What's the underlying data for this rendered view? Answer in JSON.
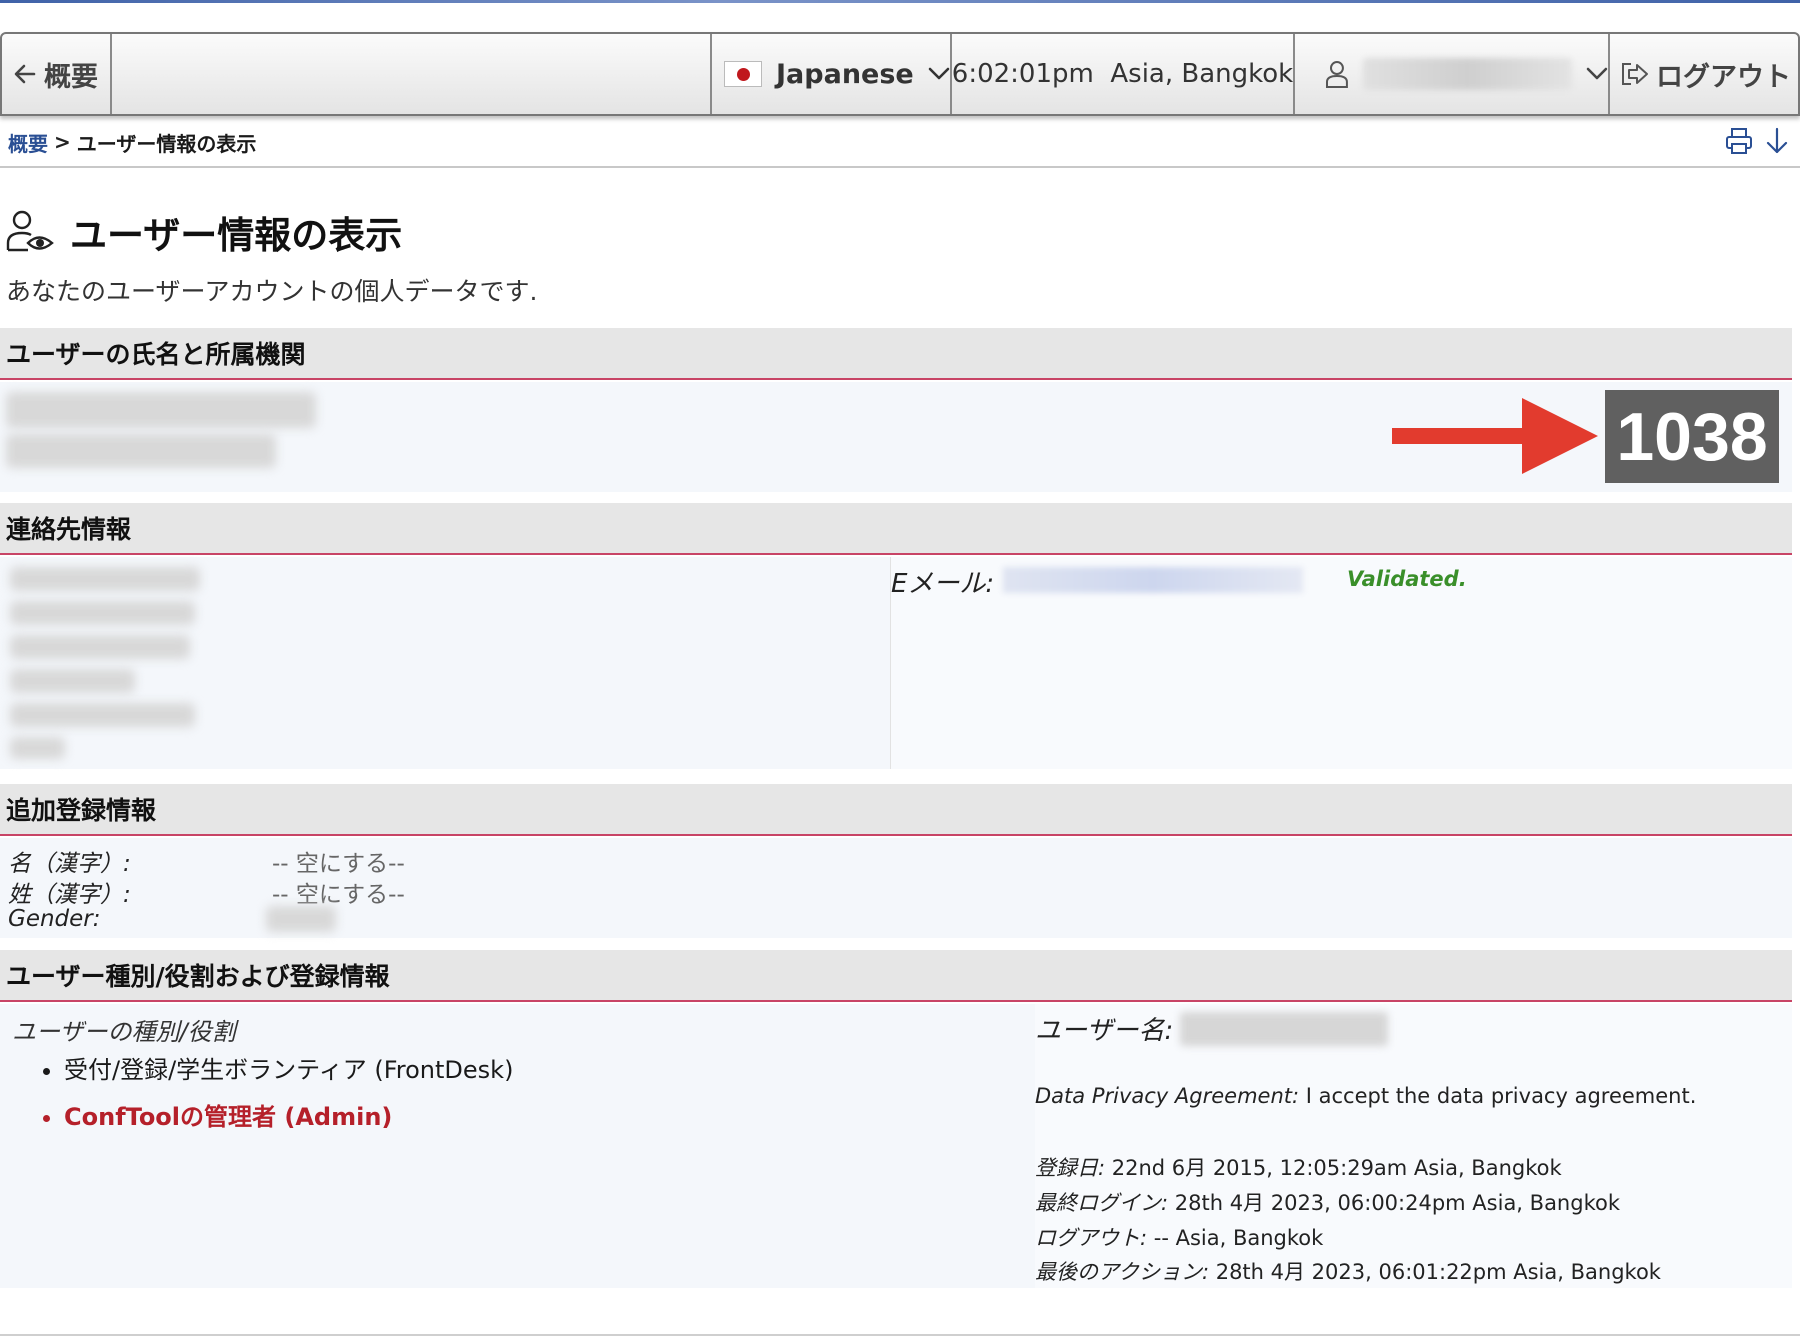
{
  "topbar": {
    "back_label": "概要",
    "language": "Japanese",
    "time": "6:02:01pm  Asia, Bangkok",
    "logout_label": "ログアウト"
  },
  "breadcrumb": {
    "home": "概要",
    "separator": ">",
    "current": "ユーザー情報の表示"
  },
  "page": {
    "title": "ユーザー情報の表示",
    "subtitle": "あなたのユーザーアカウントの個人データです."
  },
  "sections": {
    "name_affiliation": "ユーザーの氏名と所属機関",
    "contact": "連絡先情報",
    "additional": "追加登録情報",
    "roles": "ユーザー種別/役割および登録情報"
  },
  "user_id": "1038",
  "contact": {
    "email_label": "Eメール:",
    "validated": "Validated."
  },
  "additional": {
    "rows": [
      {
        "label": "名（漢字）:",
        "value": "-- 空にする--"
      },
      {
        "label": "姓（漢字）:",
        "value": "-- 空にする--"
      },
      {
        "label": "Gender:",
        "value": ""
      }
    ]
  },
  "roles": {
    "title": "ユーザーの種別/役割",
    "items": [
      "受付/登録/学生ボランティア (FrontDesk)",
      "ConfToolの管理者 (Admin)"
    ],
    "username_label": "ユーザー名:",
    "privacy_label": "Data Privacy Agreement:",
    "privacy_value": " I accept the data privacy agreement.",
    "registered_label": "登録日:",
    "registered_value": " 22nd 6月 2015, 12:05:29am Asia, Bangkok",
    "last_login_label": "最終ログイン:",
    "last_login_value": " 28th 4月 2023, 06:00:24pm Asia, Bangkok",
    "logout_label": "ログアウト:",
    "logout_value": " -- Asia, Bangkok",
    "last_action_label": "最後のアクション:",
    "last_action_value": " 28th 4月 2023, 06:01:22pm Asia, Bangkok"
  },
  "colors": {
    "accent_blue": "#2a4f94",
    "section_rule": "#c84466",
    "arrow_red": "#e23b2e",
    "validated_green": "#3a8f2a",
    "admin_red": "#b5202a"
  }
}
